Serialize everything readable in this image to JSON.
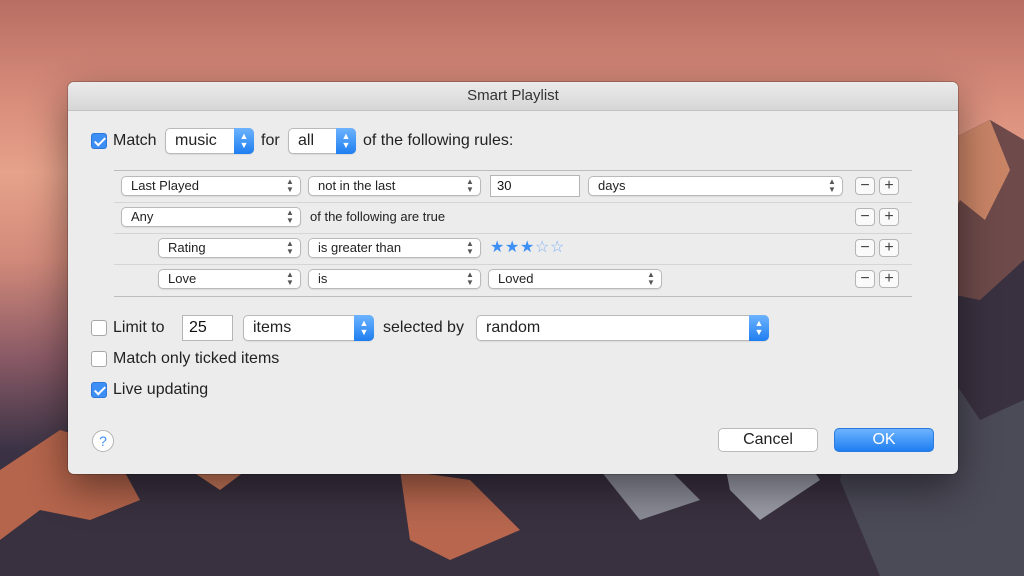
{
  "window": {
    "title": "Smart Playlist"
  },
  "match": {
    "checked": true,
    "label": "Match",
    "kind_value": "music",
    "for_label": "for",
    "scope_value": "all",
    "suffix": "of the following rules:"
  },
  "rules": [
    {
      "field": "Last Played",
      "operator": "not in the last",
      "value": "30",
      "unit": "days"
    },
    {
      "field": "Any",
      "text": "of the following are true"
    },
    {
      "field": "Rating",
      "operator": "is greater than",
      "stars_filled": 3,
      "stars_total": 5,
      "star_full": "★",
      "star_empty": "☆"
    },
    {
      "field": "Love",
      "operator": "is",
      "value": "Loved"
    }
  ],
  "buttons": {
    "remove": "−",
    "add": "+",
    "cancel": "Cancel",
    "ok": "OK",
    "help": "?"
  },
  "limit": {
    "checked": false,
    "label": "Limit to",
    "value": "25",
    "unit": "items",
    "selected_by_label": "selected by",
    "selected_by_value": "random"
  },
  "options": [
    {
      "label": "Match only ticked items",
      "checked": false
    },
    {
      "label": "Live updating",
      "checked": true
    }
  ],
  "colors": {
    "accent": "#3d8ef5"
  }
}
